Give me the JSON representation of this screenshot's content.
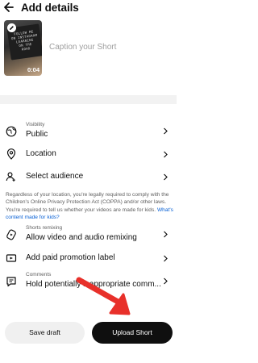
{
  "header": {
    "title": "Add details"
  },
  "media": {
    "board_lines": [
      "FOLLOW ME",
      "ON INSTAGRAM",
      "LEARNING",
      "ON THE",
      "ROAD"
    ],
    "duration": "0:04",
    "caption_placeholder": "Caption your Short"
  },
  "settings": {
    "visibility": {
      "label": "Visibility",
      "value": "Public"
    },
    "location": {
      "value": "Location"
    },
    "audience": {
      "value": "Select audience"
    },
    "audience_notice": {
      "text": "Regardless of your location, you're legally required to comply with the Children's Online Privacy Protection Act (COPPA) and/or other laws. You're required to tell us whether your videos are made for kids. ",
      "link": "What's content made for kids?"
    },
    "remixing": {
      "label": "Shorts remixing",
      "value": "Allow video and audio remixing"
    },
    "paid_promotion": {
      "value": "Add paid promotion label"
    },
    "comments": {
      "label": "Comments",
      "value": "Hold potentially inappropriate comm..."
    }
  },
  "actions": {
    "save_draft": "Save draft",
    "upload": "Upload Short"
  },
  "colors": {
    "accent_link": "#065fd4",
    "annotation_arrow": "#e8302a",
    "upload_bg": "#0f0f0f"
  },
  "icons": [
    "back-arrow-icon",
    "edit-icon",
    "globe-icon",
    "location-pin-icon",
    "audience-icon",
    "remix-icon",
    "paid-promotion-icon",
    "comment-icon",
    "chevron-right-icon"
  ]
}
